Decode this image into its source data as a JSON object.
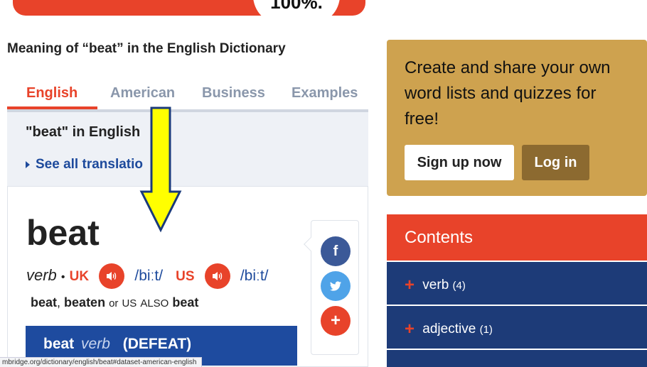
{
  "banner": {
    "percent": "100%."
  },
  "meaning_title": "Meaning of “beat” in the English Dictionary",
  "tabs": [
    {
      "label": "English",
      "active": true
    },
    {
      "label": "American",
      "active": false
    },
    {
      "label": "Business",
      "active": false
    },
    {
      "label": "Examples",
      "active": false
    }
  ],
  "translations": {
    "heading": "\"beat\" in English",
    "see_all": "See all translatio"
  },
  "entry": {
    "headword": "beat",
    "pos": "verb",
    "separator": "•",
    "uk_label": "UK",
    "uk_pron": "/biːt/",
    "us_label": "US",
    "us_pron": "/biːt/",
    "forms": {
      "form1": "beat",
      "comma": ",",
      "form2": "beaten",
      "or": "or",
      "us": "US",
      "also": "ALSO",
      "form3": "beat"
    },
    "sense": {
      "word": "beat",
      "pos": "verb",
      "guideword": "(DEFEAT)"
    }
  },
  "share": {
    "facebook_glyph": "f",
    "twitter_glyph": "t",
    "more_glyph": "+"
  },
  "promo": {
    "text": "Create and share your own word lists and quizzes for free!",
    "signup_label": "Sign up now",
    "login_label": "Log in"
  },
  "contents": {
    "title": "Contents",
    "items": [
      {
        "label": "verb",
        "count": "(4)"
      },
      {
        "label": "adjective",
        "count": "(1)"
      }
    ]
  },
  "status_url": "mbridge.org/dictionary/english/beat#dataset-american-english",
  "colors": {
    "accent_red": "#e8432a",
    "navy": "#1d3b78",
    "link_blue": "#1d4a9c",
    "promo_gold": "#cea24f",
    "annotation_arrow": "#ffff00"
  },
  "icons": [
    "speaker-icon",
    "facebook-icon",
    "twitter-icon",
    "plus-icon",
    "triangle-right-icon",
    "down-arrow-annotation"
  ]
}
